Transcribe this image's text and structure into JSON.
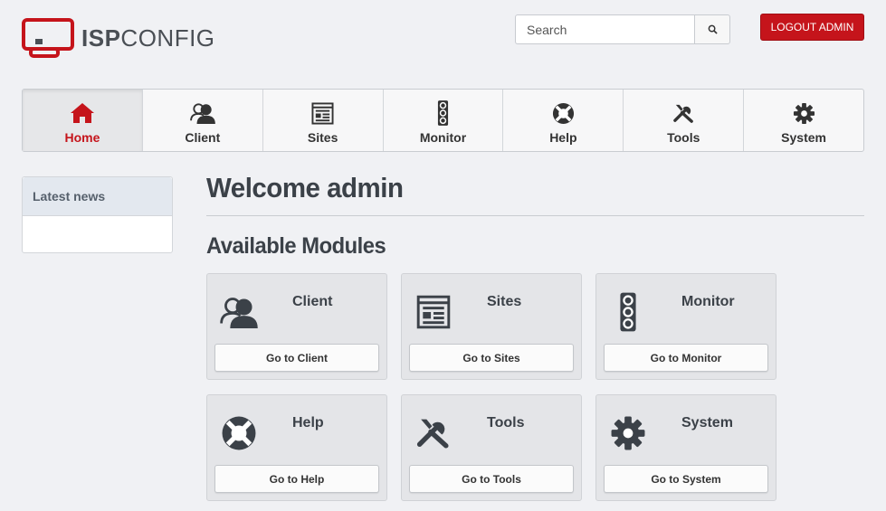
{
  "logo": {
    "isp": "ISP",
    "config": "CONFIG"
  },
  "search": {
    "placeholder": "Search"
  },
  "header": {
    "logout_label": "LOGOUT ADMIN"
  },
  "nav": {
    "items": [
      {
        "label": "Home",
        "icon": "home-icon",
        "active": true
      },
      {
        "label": "Client",
        "icon": "users-icon"
      },
      {
        "label": "Sites",
        "icon": "browser-window-icon"
      },
      {
        "label": "Monitor",
        "icon": "traffic-light-icon"
      },
      {
        "label": "Help",
        "icon": "lifebuoy-icon"
      },
      {
        "label": "Tools",
        "icon": "wrench-screwdriver-icon"
      },
      {
        "label": "System",
        "icon": "gear-icon"
      }
    ]
  },
  "sidebar": {
    "heading": "Latest news"
  },
  "main": {
    "title": "Welcome admin",
    "section_title": "Available Modules",
    "modules": [
      {
        "title": "Client",
        "button": "Go to Client",
        "icon": "users-icon"
      },
      {
        "title": "Sites",
        "button": "Go to Sites",
        "icon": "browser-window-icon"
      },
      {
        "title": "Monitor",
        "button": "Go to Monitor",
        "icon": "traffic-light-icon"
      },
      {
        "title": "Help",
        "button": "Go to Help",
        "icon": "lifebuoy-icon"
      },
      {
        "title": "Tools",
        "button": "Go to Tools",
        "icon": "wrench-screwdriver-icon"
      },
      {
        "title": "System",
        "button": "Go to System",
        "icon": "gear-icon"
      }
    ]
  },
  "colors": {
    "accent": "#c5141b",
    "text": "#3b4148",
    "background": "#f0f1f4"
  }
}
